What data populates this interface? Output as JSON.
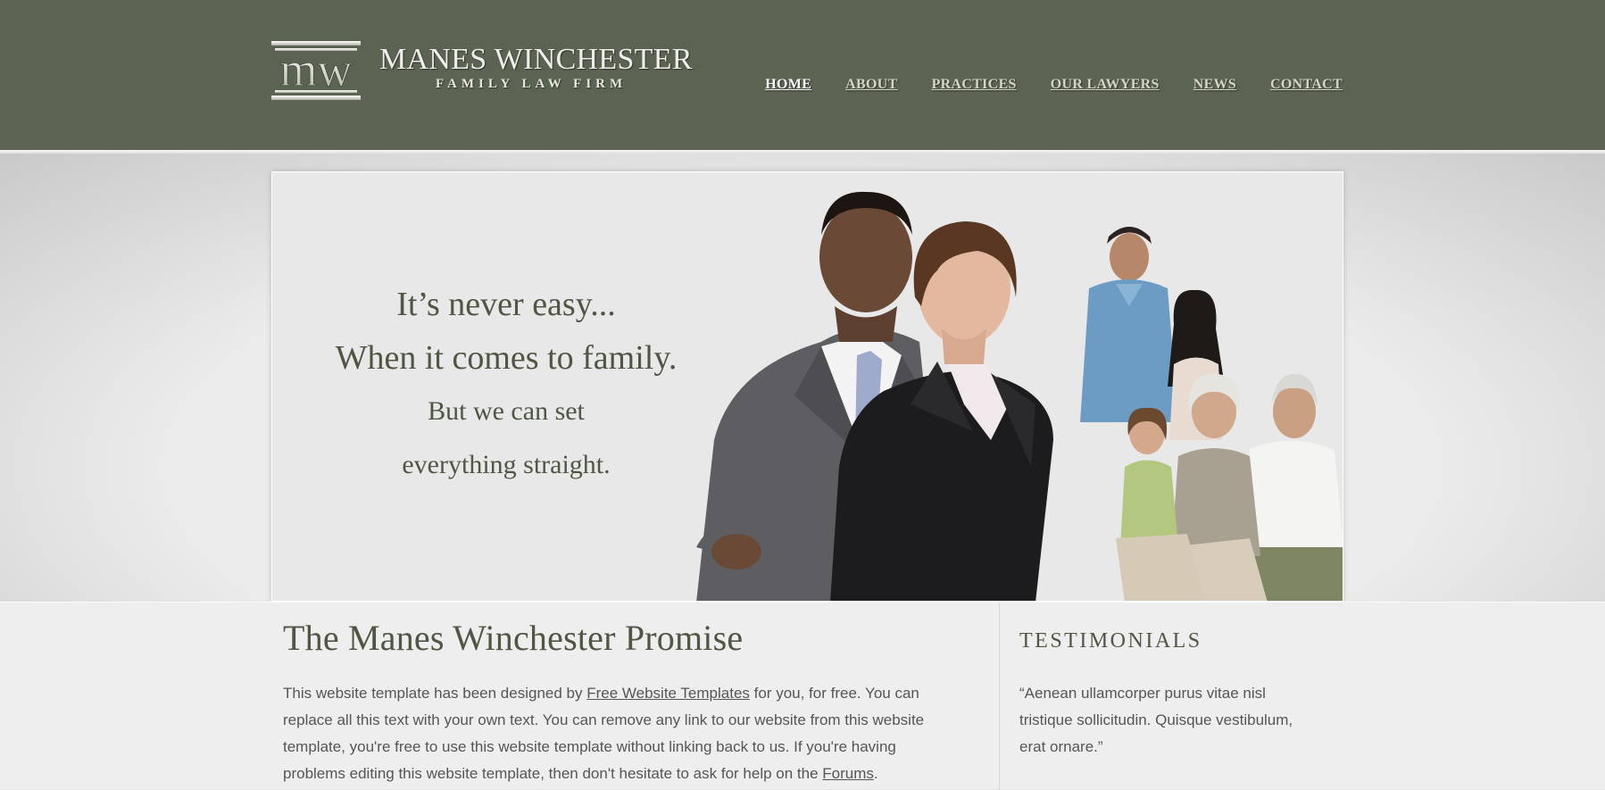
{
  "brand": {
    "monogram": "mw",
    "name": "MANES WINCHESTER",
    "tagline": "FAMILY LAW FIRM"
  },
  "nav": [
    {
      "label": "HOME",
      "active": true
    },
    {
      "label": "ABOUT",
      "active": false
    },
    {
      "label": "PRACTICES",
      "active": false
    },
    {
      "label": "OUR LAWYERS",
      "active": false
    },
    {
      "label": "NEWS",
      "active": false
    },
    {
      "label": "CONTACT",
      "active": false
    }
  ],
  "hero": {
    "line1": "It’s never easy...",
    "line2": "When it comes to family.",
    "line3": "But we can set",
    "line4": "everything straight."
  },
  "main": {
    "title": "The Manes Winchester Promise",
    "text_1": "This website template has been designed by ",
    "link_1": "Free Website Templates",
    "text_2": " for you, for free. You can replace all this text with your own text. You can remove any link to our website from this website template, you're free to use this website template without linking back to us. If you're having problems editing this website template, then don't hesitate to ask for help on the ",
    "link_2": "Forums",
    "text_3": "."
  },
  "sidebar": {
    "title": "TESTIMONIALS",
    "quote": "“Aenean ullamcorper purus vitae nisl tristique sollicitudin. Quisque vestibulum, erat ornare.”"
  },
  "colors": {
    "header_bg": "#5b6352",
    "heading_text": "#4f5644",
    "body_text": "#555555",
    "page_bg": "#e4e4e4"
  }
}
